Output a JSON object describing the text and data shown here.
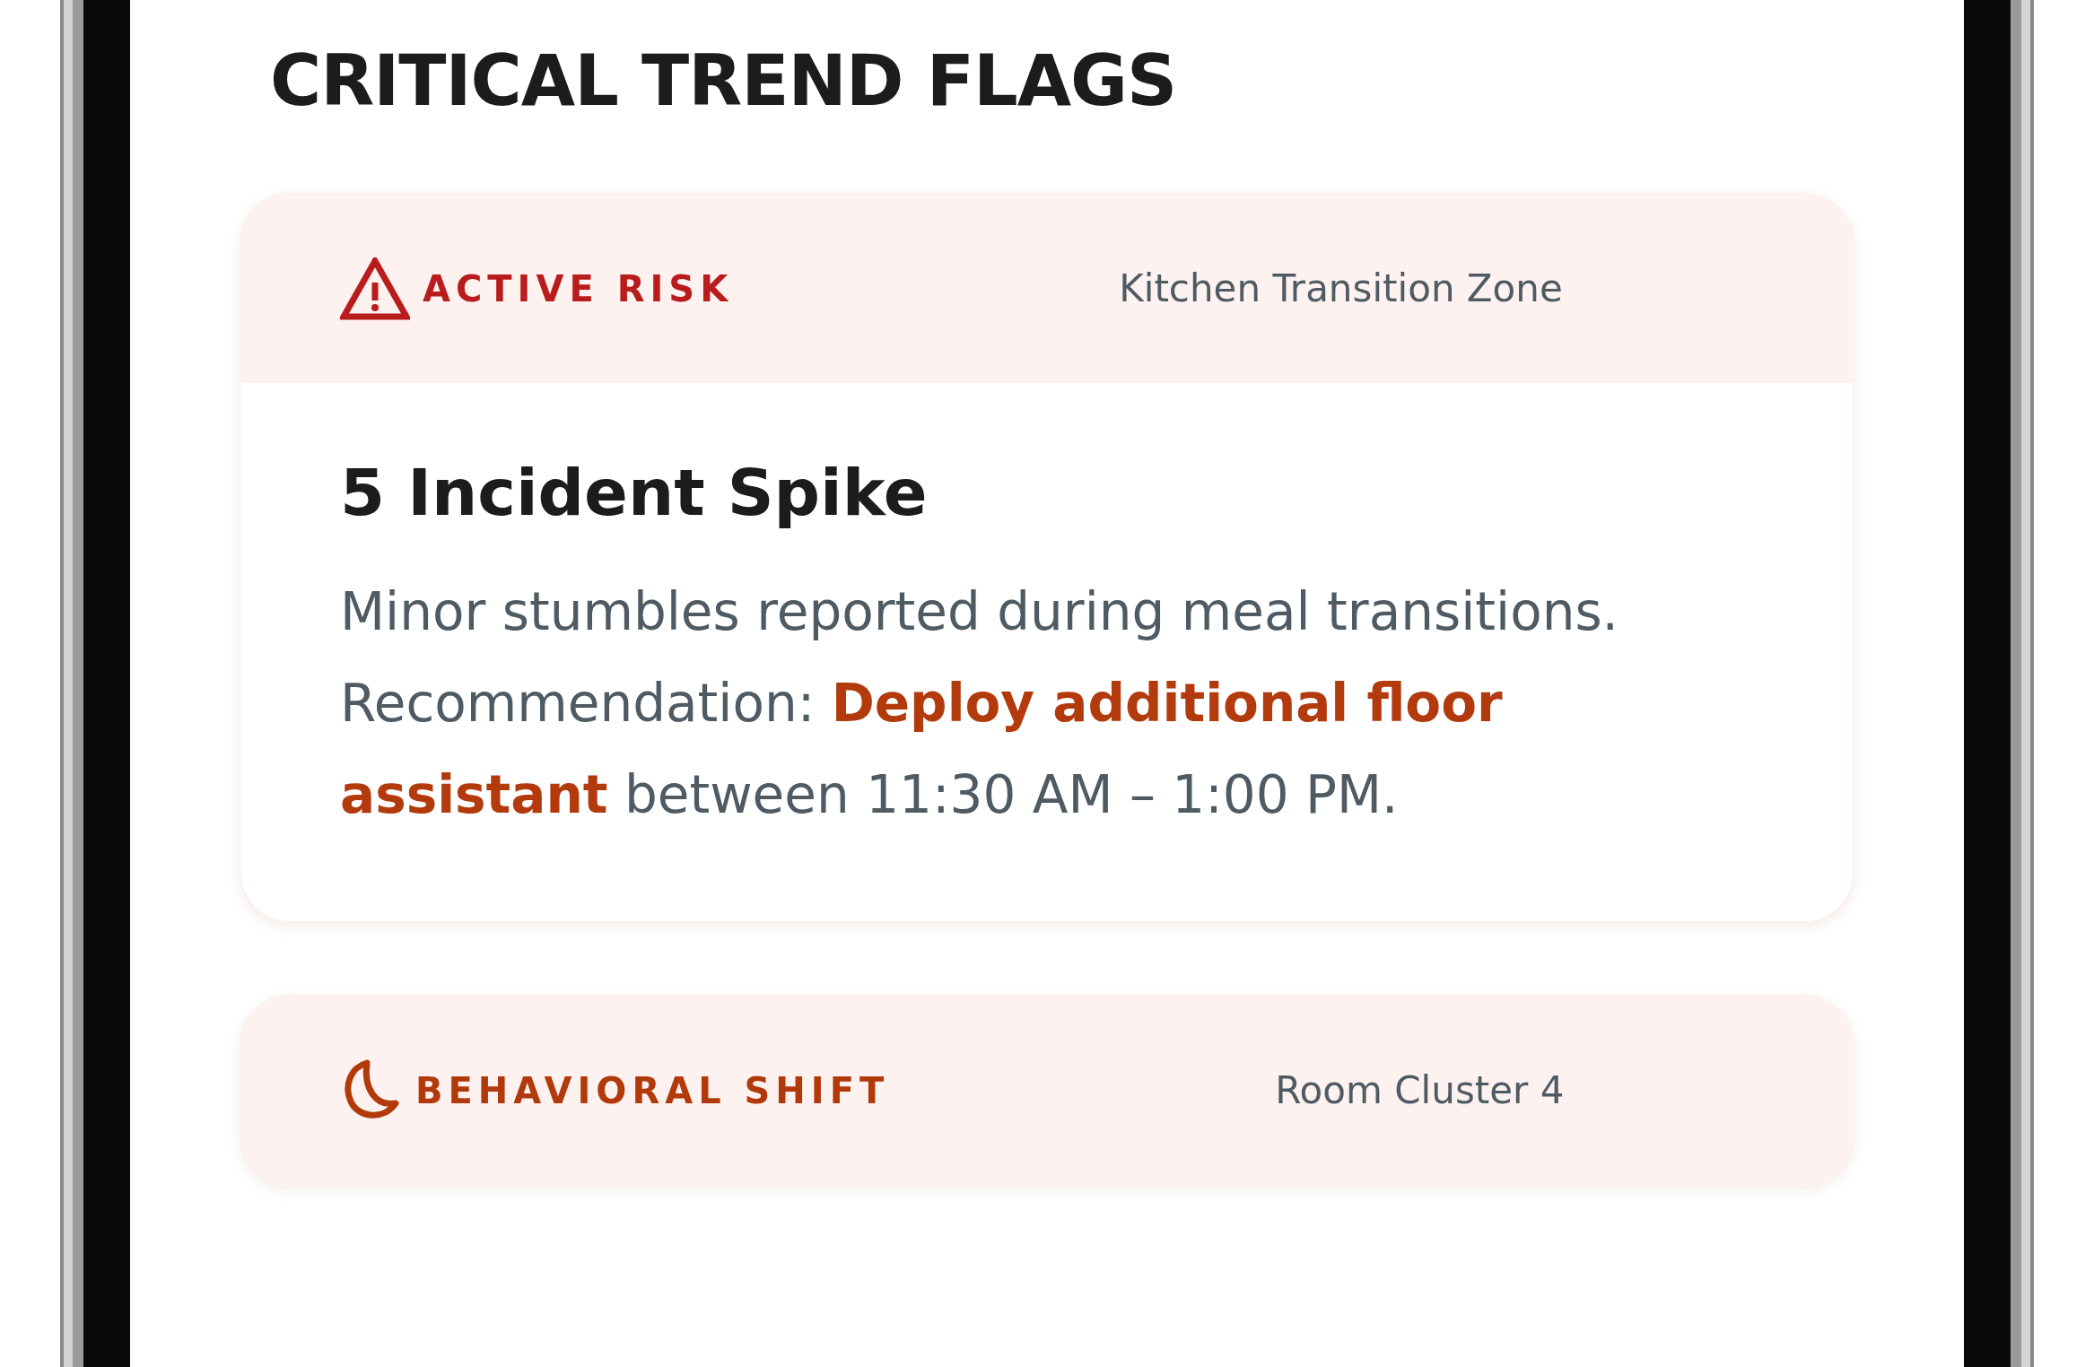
{
  "page_title": "CRITICAL TREND FLAGS",
  "flags": [
    {
      "kind": "risk",
      "label": "ACTIVE RISK",
      "location": "Kitchen Transition Zone",
      "heading": "5 Incident Spike",
      "body": "Minor stumbles reported during meal transitions. Recommendation: **Deploy additional floor assistant** between 11:30 AM – 1:00 PM."
    },
    {
      "kind": "shift",
      "label": "BEHAVIORAL SHIFT",
      "location": "Room Cluster 4"
    }
  ]
}
